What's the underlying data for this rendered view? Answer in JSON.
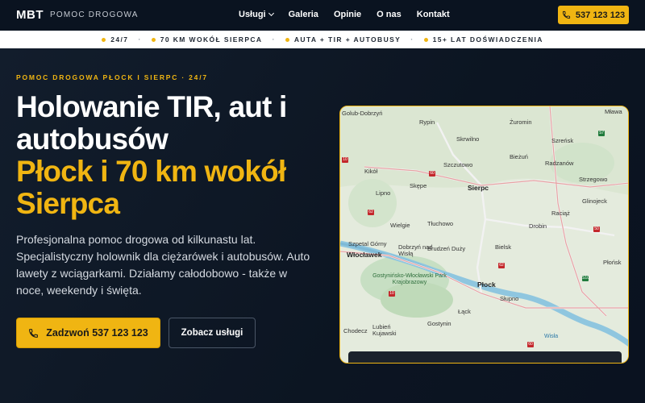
{
  "brand": {
    "mark": "MBT",
    "name": "POMOC DROGOWA"
  },
  "nav": {
    "items": [
      {
        "label": "Usługi",
        "dropdown": true
      },
      {
        "label": "Galeria"
      },
      {
        "label": "Opinie"
      },
      {
        "label": "O nas"
      },
      {
        "label": "Kontakt"
      }
    ],
    "phone_label": "537 123 123"
  },
  "strip": {
    "items": [
      "24/7",
      "70 KM WOKÓŁ SIERPCA",
      "AUTA + TIR + AUTOBUSY",
      "15+ LAT DOŚWIADCZENIA"
    ],
    "separator": "·"
  },
  "hero": {
    "eyebrow": "POMOC DROGOWA PŁOCK I SIERPC · 24/7",
    "title_line1": "Holowanie TIR, aut i",
    "title_line2": "autobusów",
    "title_gold_line1": "Płock i 70 km wokół",
    "title_gold_line2": "Sierpca",
    "lead": "Profesjonalna pomoc drogowa od kilkunastu lat. Specjalistyczny holownik dla ciężarówek i autobusów. Auto lawety z wciągarkami. Działamy całodobowo - także w noce, weekendy i święta.",
    "cta_call": "Zadzwoń 537 123 123",
    "cta_services": "Zobacz usługi"
  },
  "map": {
    "labels": [
      {
        "text": "Golub-Dobrzyń"
      },
      {
        "text": "Rypin"
      },
      {
        "text": "Żuromin"
      },
      {
        "text": "Mława"
      },
      {
        "text": "Skrwilno"
      },
      {
        "text": "Szreńsk"
      },
      {
        "text": "Bieżuń"
      },
      {
        "text": "Radzanów"
      },
      {
        "text": "Kikół"
      },
      {
        "text": "Szczutowo"
      },
      {
        "text": "Strzegowo"
      },
      {
        "text": "Skępe"
      },
      {
        "text": "Lipno"
      },
      {
        "text": "Sierpc"
      },
      {
        "text": "Glinojeck"
      },
      {
        "text": "Raciąż"
      },
      {
        "text": "Tłuchowo"
      },
      {
        "text": "Wielgie"
      },
      {
        "text": "Drobin"
      },
      {
        "text": "Szpetal Górny"
      },
      {
        "text": "Dobrzyń nad Wisłą"
      },
      {
        "text": "Brudzeń Duży"
      },
      {
        "text": "Bielsk"
      },
      {
        "text": "Włocławek"
      },
      {
        "text": "Płońsk"
      },
      {
        "text": "Gostynińsko-Włocławski Park Krajobrazowy"
      },
      {
        "text": "Płock"
      },
      {
        "text": "Słupno"
      },
      {
        "text": "Łąck"
      },
      {
        "text": "Chodecz"
      },
      {
        "text": "Lubień Kujawski"
      },
      {
        "text": "Gostynin"
      },
      {
        "text": "Wisła"
      }
    ],
    "route_numbers": [
      "10",
      "60",
      "62",
      "7",
      "50",
      "S7",
      "S10",
      "62",
      "10",
      "60"
    ]
  },
  "colors": {
    "accent": "#f0b512",
    "bg": "#0b1421",
    "strip_bg": "#ffffff"
  },
  "icons": {
    "phone": "phone-icon",
    "chevron": "chevron-down-icon"
  }
}
